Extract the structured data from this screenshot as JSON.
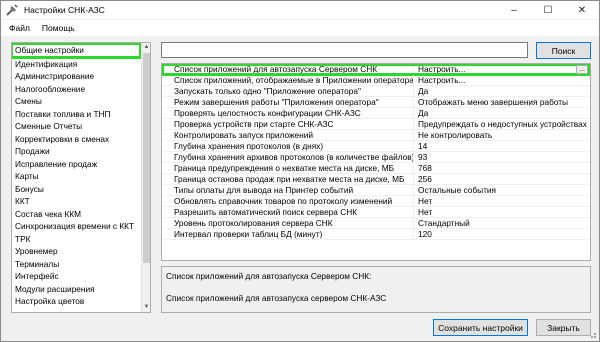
{
  "window": {
    "title": "Настройки СНК-АЗС"
  },
  "menu": [
    "Файл",
    "Помощь"
  ],
  "sidebar": {
    "items": [
      "Общие настройки",
      "Идентификация",
      "Администрирование",
      "Налогообложение",
      "Смены",
      "Поставки топлива и ТНП",
      "Сменные Отчеты",
      "Корректировки в сменах",
      "Продажи",
      "Исправление продаж",
      "Карты",
      "Бонусы",
      "ККТ",
      "Состав чека ККМ",
      "Синхронизация времени с ККТ",
      "ТРК",
      "Уровнемер",
      "Терминалы",
      "Интерфейс",
      "Модули расширения",
      "Настройка цветов"
    ],
    "selected_index": 0
  },
  "search": {
    "value": "",
    "button_label": "Поиск"
  },
  "grid": {
    "rows": [
      {
        "name": "Список приложений для автозапуска Сервером СНК",
        "value": "Настроить..."
      },
      {
        "name": "Список приложений, отображаемые в Приложении оператора",
        "value": "Настроить..."
      },
      {
        "name": "Запускать только одно \"Приложение оператора\"",
        "value": "Да"
      },
      {
        "name": "Режим завершения работы \"Приложения оператора\"",
        "value": "Отображать меню завершения работы"
      },
      {
        "name": "Проверять целостность конфигурации СНК-АЗС",
        "value": "Да"
      },
      {
        "name": "Проверка устройств при старте СНК-АЗС",
        "value": "Предупреждать о недоступных устройствах"
      },
      {
        "name": "Контролировать запуск приложений",
        "value": "Не контролировать"
      },
      {
        "name": "Глубина хранения протоколов (в днях)",
        "value": "14"
      },
      {
        "name": "Глубина хранения архивов протоколов (в количестве файлов)",
        "value": "93"
      },
      {
        "name": "Граница предупреждения о нехватке места на диске, МБ",
        "value": "768"
      },
      {
        "name": "Граница останова продаж при нехватке места на диске, МБ",
        "value": "256"
      },
      {
        "name": "Типы оплаты для вывода на Принтер событий",
        "value": "Остальные события"
      },
      {
        "name": "Обновлять справочник товаров по протоколу изменений",
        "value": "Нет"
      },
      {
        "name": "Разрешить автоматический поиск сервера СНК",
        "value": "Нет"
      },
      {
        "name": "Уровень протоколирования сервера СНК",
        "value": "Стандартный"
      },
      {
        "name": "Интервал проверки таблиц БД (минут)",
        "value": "120"
      }
    ],
    "ellipsis_label": "..."
  },
  "description": {
    "title": "Список приложений для автозапуска Сервером СНК:",
    "text": "Список приложений для автозапуска сервером СНК-АЗС"
  },
  "buttons": {
    "save": "Сохранить настройки",
    "close": "Закрыть"
  },
  "colors": {
    "highlight": "#2fd62f",
    "accent": "#0078d7"
  }
}
